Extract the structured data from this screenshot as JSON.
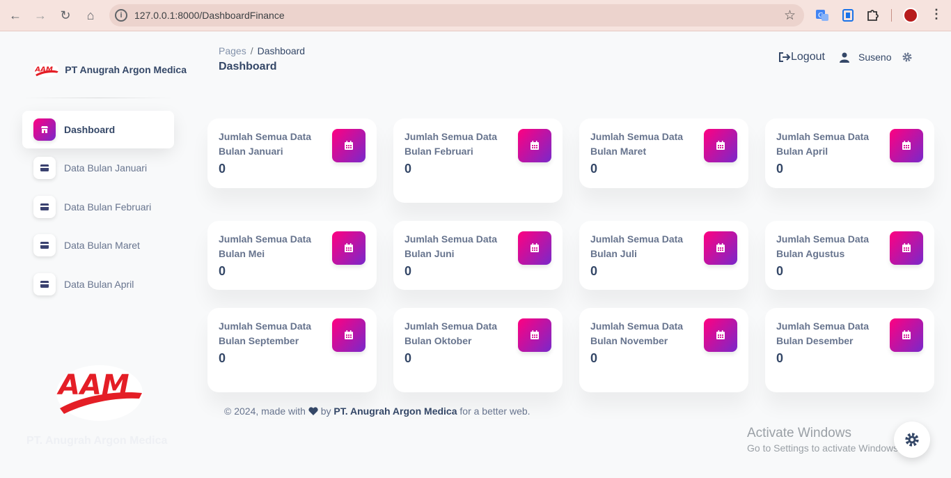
{
  "browser": {
    "url": "127.0.0.1:8000/DashboardFinance"
  },
  "sidebar": {
    "brand": "PT Anugrah Argon Medica",
    "items": [
      {
        "label": "Dashboard",
        "active": true
      },
      {
        "label": "Data Bulan Januari"
      },
      {
        "label": "Data Bulan Februari"
      },
      {
        "label": "Data Bulan Maret"
      },
      {
        "label": "Data Bulan April"
      }
    ],
    "footer_brand": "PT. Anugrah Argon Medica"
  },
  "header": {
    "breadcrumb_root": "Pages",
    "breadcrumb_sep": "/",
    "breadcrumb_current": "Dashboard",
    "title": "Dashboard",
    "logout": "Logout",
    "user": "Suseno"
  },
  "cards": [
    {
      "label": "Jumlah Semua Data Bulan Januari",
      "value": "0"
    },
    {
      "label": "Jumlah Semua Data Bulan Februari",
      "value": "0"
    },
    {
      "label": "Jumlah Semua Data Bulan Maret",
      "value": "0"
    },
    {
      "label": "Jumlah Semua Data Bulan April",
      "value": "0"
    },
    {
      "label": "Jumlah Semua Data Bulan Mei",
      "value": "0"
    },
    {
      "label": "Jumlah Semua Data Bulan Juni",
      "value": "0"
    },
    {
      "label": "Jumlah Semua Data Bulan Juli",
      "value": "0"
    },
    {
      "label": "Jumlah Semua Data Bulan Agustus",
      "value": "0"
    },
    {
      "label": "Jumlah Semua Data Bulan September",
      "value": "0"
    },
    {
      "label": "Jumlah Semua Data Bulan Oktober",
      "value": "0"
    },
    {
      "label": "Jumlah Semua Data Bulan November",
      "value": "0"
    },
    {
      "label": "Jumlah Semua Data Bulan Desember",
      "value": "0"
    }
  ],
  "footer": {
    "prefix": "© 2024, made with",
    "by": "by",
    "company": "PT. Anugrah Argon Medica",
    "suffix": "for a better web."
  },
  "watermark": {
    "title": "Activate Windows",
    "subtitle": "Go to Settings to activate Windows."
  },
  "colors": {
    "accent_gradient_start": "#7928ca",
    "accent_gradient_end": "#ff0080",
    "text_dark": "#344767",
    "text_muted": "#67748e"
  }
}
